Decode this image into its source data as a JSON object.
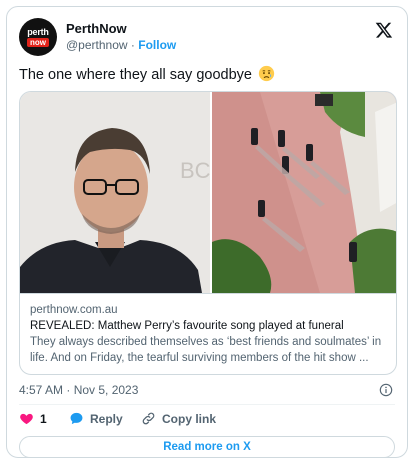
{
  "account": {
    "name": "PerthNow",
    "handle": "@perthnow",
    "separator": "·",
    "follow_label": "Follow",
    "avatar_line1": "perth",
    "avatar_line2": "now"
  },
  "tweet": {
    "text": "The one where they all say goodbye",
    "emoji": "crying-face-emoji"
  },
  "link_card": {
    "domain": "perthnow.com.au",
    "headline": "REVEALED: Matthew Perry’s favourite song played at funeral",
    "description": "They always described themselves as ‘best friends and soulmates’ in life. And on Friday, the tearful surviving members of the hit show ..."
  },
  "timestamp": "4:57 AM · Nov 5, 2023",
  "actions": {
    "like_count": "1",
    "reply_label": "Reply",
    "copy_label": "Copy link"
  },
  "read_more_label": "Read more on X",
  "colors": {
    "accent": "#1d9bf0",
    "like": "#f91880",
    "brand_red": "#e2231a"
  }
}
